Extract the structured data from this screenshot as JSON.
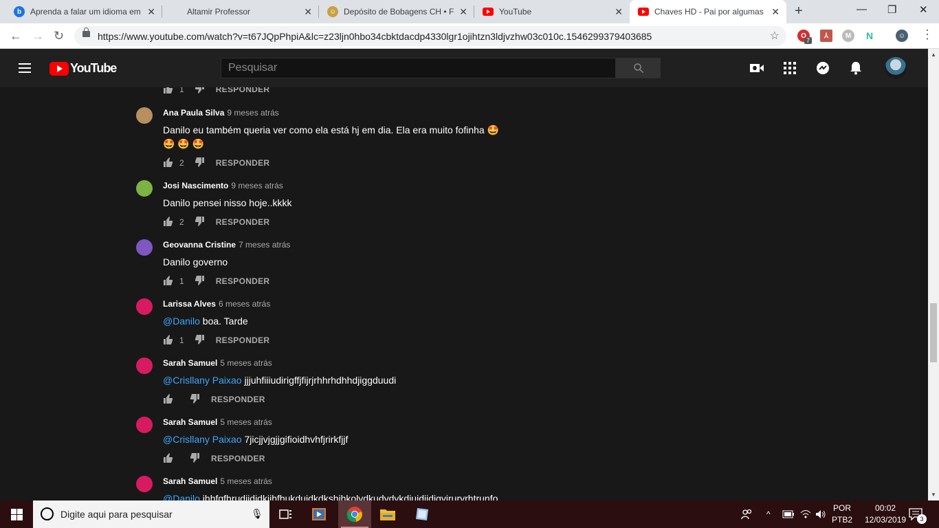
{
  "browser": {
    "tabs": [
      {
        "title": "Aprenda a falar um idioma em",
        "favicon": "bing-icon",
        "color": "#1a73e8"
      },
      {
        "title": "Altamir Professor",
        "favicon": "",
        "color": ""
      },
      {
        "title": "Depósito de Bobagens CH • Fó",
        "favicon": "chaves-icon",
        "color": "#c8a040"
      },
      {
        "title": "YouTube",
        "favicon": "youtube-icon",
        "color": "#ff0000"
      },
      {
        "title": "Chaves HD - Pai por algumas h",
        "favicon": "youtube-icon",
        "color": "#ff0000"
      }
    ],
    "url": "https://www.youtube.com/watch?v=t67JQpPhpiA&lc=z23ljn0hbo34cbktdacdp4330lgr1ojihtzn3ldjvzhw03c010c.1546299379403685",
    "extension_badge": "7"
  },
  "youtube": {
    "logo_text": "YouTube",
    "search_placeholder": "Pesquisar"
  },
  "comments": [
    {
      "author": "Ana Paula Silva",
      "time": "9 meses atrás",
      "mention": "",
      "text": "Danilo eu também queria ver como ela está hj em dia.  Ela era muito fofinha 🤩",
      "text2": "🤩 🤩 🤩",
      "likes": "2",
      "avatar_color": "#b89060",
      "avatar_letter": ""
    },
    {
      "author": "Josi Nascimento",
      "time": "9 meses atrás",
      "mention": "",
      "text": "Danilo pensei nisso hoje..kkkk",
      "text2": "",
      "likes": "2",
      "avatar_color": "#7cb342",
      "avatar_letter": ""
    },
    {
      "author": "Geovanna Cristine",
      "time": "7 meses atrás",
      "mention": "",
      "text": "Danilo governo",
      "text2": "",
      "likes": "1",
      "avatar_color": "#7e57c2",
      "avatar_letter": ""
    },
    {
      "author": "Larissa Alves",
      "time": "6 meses atrás",
      "mention": "@Danilo",
      "text": " boa.  Tarde",
      "text2": "",
      "likes": "1",
      "avatar_color": "#d81b60",
      "avatar_letter": ""
    },
    {
      "author": "Sarah Samuel",
      "time": "5 meses atrás",
      "mention": "@Crisllany Paixao",
      "text": " jjjuhfiiiudirigffjfijrjrhhrhdhhdjiggduudi",
      "text2": "",
      "likes": "",
      "avatar_color": "#d81b60",
      "avatar_letter": ""
    },
    {
      "author": "Sarah Samuel",
      "time": "5 meses atrás",
      "mention": "@Crisllany Paixao",
      "text": " 7jicjjvjgjjgifioidhvhfjrirkfjjf",
      "text2": "",
      "likes": "",
      "avatar_color": "#d81b60",
      "avatar_letter": ""
    },
    {
      "author": "Sarah Samuel",
      "time": "5 meses atrás",
      "mention": "@Danilo",
      "text": " jhhfgfhrudjjdjdkjjhfhukdujdkdkshjhkolydkudydykdjujdjjdjgyiruryrhtrunfo",
      "text2": "",
      "likes": "",
      "avatar_color": "#d81b60",
      "avatar_letter": ""
    }
  ],
  "partial_top_comment": {
    "likes": "1"
  },
  "reply_label": "RESPONDER",
  "taskbar": {
    "search_placeholder": "Digite aqui para pesquisar",
    "lang_line1": "POR",
    "lang_line2": "PTB2",
    "time": "00:02",
    "date": "12/03/2019",
    "notification_count": "3"
  }
}
